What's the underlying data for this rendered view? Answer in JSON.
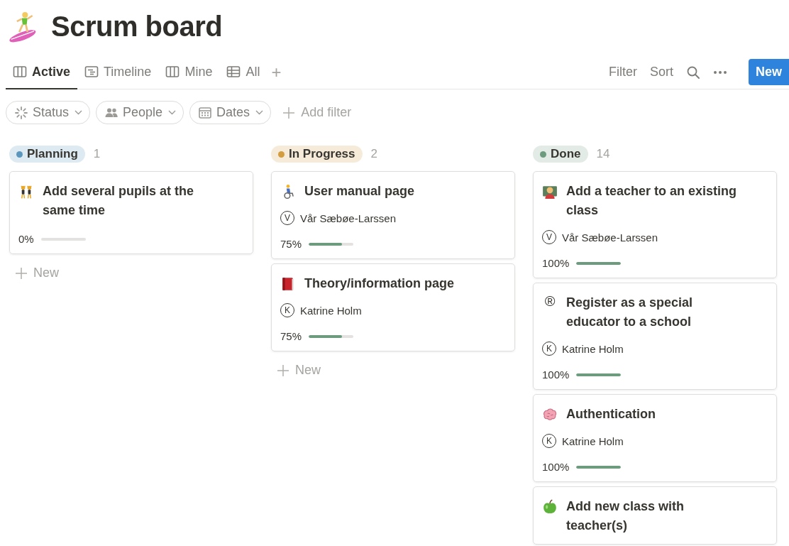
{
  "page": {
    "title": "Scrum board"
  },
  "views": [
    {
      "label": "Active",
      "kind": "board",
      "selected": true
    },
    {
      "label": "Timeline",
      "kind": "timeline",
      "selected": false
    },
    {
      "label": "Mine",
      "kind": "board",
      "selected": false
    },
    {
      "label": "All",
      "kind": "table",
      "selected": false
    }
  ],
  "add_view": "+",
  "actions": [
    "Filter",
    "Sort"
  ],
  "new_button": "New",
  "filters": [
    {
      "label": "Status",
      "kind": "status"
    },
    {
      "label": "People",
      "kind": "people"
    },
    {
      "label": "Dates",
      "kind": "dates"
    }
  ],
  "add_filter": "Add filter",
  "columns": [
    {
      "name": "Planning",
      "count": "1",
      "color": "#5b97bd",
      "new_label": "New",
      "cards": [
        {
          "title": "Add several pupils at the same time",
          "progress": "0%",
          "level": 0
        }
      ]
    },
    {
      "name": "In Progress",
      "count": "2",
      "color": "#d39c3f",
      "new_label": "New",
      "cards": [
        {
          "title": "User manual page",
          "person": "Vår Sæbøe-Larssen",
          "initial": "V",
          "progress": "75%",
          "level": 0.75
        },
        {
          "title": "Theory/information page",
          "person": "Katrine Holm",
          "initial": "K",
          "progress": "75%",
          "level": 0.75
        }
      ]
    },
    {
      "name": "Done",
      "count": "14",
      "color": "#6c9b7d",
      "cards": [
        {
          "title": "Add a teacher to an existing class",
          "person": "Vår Sæbøe-Larssen",
          "initial": "V",
          "progress": "100%",
          "level": 1
        },
        {
          "symbol": "®",
          "title": "Register as a special educator to a school",
          "person": "Katrine Holm",
          "initial": "K",
          "progress": "100%",
          "level": 1
        },
        {
          "title": "Authentication",
          "person": "Katrine Holm",
          "initial": "K",
          "progress": "100%",
          "level": 1
        },
        {
          "title": "Add new class with teacher(s)"
        }
      ]
    }
  ]
}
